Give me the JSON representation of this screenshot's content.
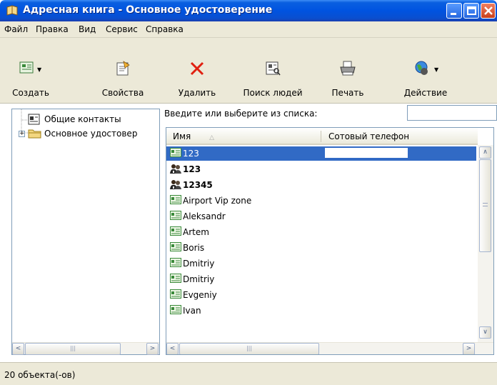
{
  "window": {
    "title": "Адресная книга - Основное удостоверение"
  },
  "menu": {
    "items": [
      {
        "label": "Файл"
      },
      {
        "label": "Правка"
      },
      {
        "label": "Вид"
      },
      {
        "label": "Сервис"
      },
      {
        "label": "Справка"
      }
    ]
  },
  "toolbar": {
    "buttons": [
      {
        "label": "Создать",
        "icon": "new-contact-icon"
      },
      {
        "label": "Свойства",
        "icon": "properties-icon"
      },
      {
        "label": "Удалить",
        "icon": "delete-icon"
      },
      {
        "label": "Поиск людей",
        "icon": "find-people-icon"
      },
      {
        "label": "Печать",
        "icon": "print-icon"
      },
      {
        "label": "Действие",
        "icon": "action-icon"
      }
    ]
  },
  "tree": {
    "items": [
      {
        "label": "Общие контакты",
        "icon": "contacts-folder-icon"
      },
      {
        "label": "Основное удостовер",
        "icon": "folder-icon"
      }
    ]
  },
  "search": {
    "label": "Введите или выберите из списка:",
    "value": ""
  },
  "list": {
    "columns": [
      {
        "label": "Имя"
      },
      {
        "label": "Сотовый телефон"
      }
    ],
    "rows": [
      {
        "name": "123",
        "icon": "contact-card-icon",
        "selected": true,
        "bold": false
      },
      {
        "name": "123",
        "icon": "group-icon",
        "selected": false,
        "bold": true
      },
      {
        "name": "12345",
        "icon": "group-icon",
        "selected": false,
        "bold": true
      },
      {
        "name": "Airport Vip zone",
        "icon": "contact-card-icon",
        "selected": false,
        "bold": false
      },
      {
        "name": "Aleksandr",
        "icon": "contact-card-icon",
        "selected": false,
        "bold": false
      },
      {
        "name": "Artem",
        "icon": "contact-card-icon",
        "selected": false,
        "bold": false
      },
      {
        "name": "Boris",
        "icon": "contact-card-icon",
        "selected": false,
        "bold": false
      },
      {
        "name": "Dmitriy",
        "icon": "contact-card-icon",
        "selected": false,
        "bold": false
      },
      {
        "name": "Dmitriy",
        "icon": "contact-card-icon",
        "selected": false,
        "bold": false
      },
      {
        "name": "Evgeniy",
        "icon": "contact-card-icon",
        "selected": false,
        "bold": false
      },
      {
        "name": "Ivan",
        "icon": "contact-card-icon",
        "selected": false,
        "bold": false
      }
    ]
  },
  "status": {
    "text": "20 объекта(-ов)"
  }
}
